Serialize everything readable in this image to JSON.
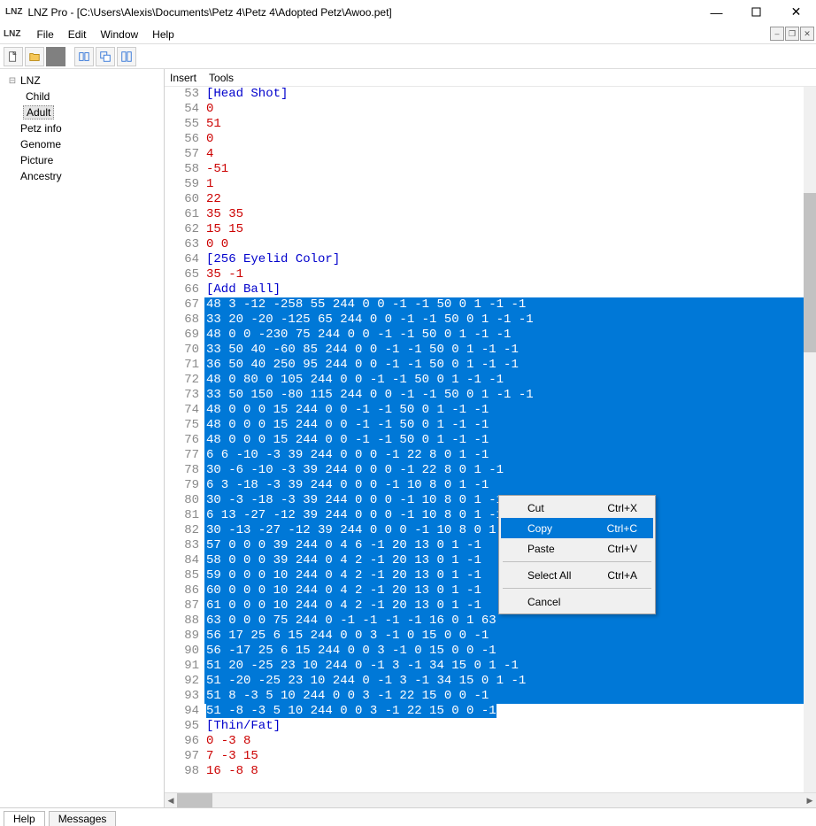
{
  "window": {
    "title": "LNZ Pro - [C:\\Users\\Alexis\\Documents\\Petz 4\\Petz 4\\Adopted Petz\\Awoo.pet]"
  },
  "menubar": [
    "File",
    "Edit",
    "Window",
    "Help"
  ],
  "sidebar": {
    "root": "LNZ",
    "children": [
      "Child",
      "Adult"
    ],
    "selected": "Adult",
    "items": [
      "Petz info",
      "Genome",
      "Picture",
      "Ancestry"
    ]
  },
  "submenu": [
    "Insert",
    "Tools"
  ],
  "context_menu": [
    {
      "label": "Cut",
      "shortcut": "Ctrl+X"
    },
    {
      "label": "Copy",
      "shortcut": "Ctrl+C",
      "hover": true
    },
    {
      "label": "Paste",
      "shortcut": "Ctrl+V"
    },
    "-",
    {
      "label": "Select All",
      "shortcut": "Ctrl+A"
    },
    "-",
    {
      "label": "Cancel",
      "shortcut": ""
    }
  ],
  "status_tabs": [
    "Help",
    "Messages"
  ],
  "editor": {
    "first_line": 53,
    "selection_start": 67,
    "selection_end": 94,
    "lines": [
      {
        "n": 53,
        "t": "section",
        "text": "[Head Shot]"
      },
      {
        "n": 54,
        "t": "num",
        "text": "0"
      },
      {
        "n": 55,
        "t": "num",
        "text": "51"
      },
      {
        "n": 56,
        "t": "num",
        "text": "0"
      },
      {
        "n": 57,
        "t": "num",
        "text": "4"
      },
      {
        "n": 58,
        "t": "num",
        "text": "-51"
      },
      {
        "n": 59,
        "t": "num",
        "text": "1"
      },
      {
        "n": 60,
        "t": "num",
        "text": "22"
      },
      {
        "n": 61,
        "t": "num",
        "text": "35 35"
      },
      {
        "n": 62,
        "t": "num",
        "text": "15 15"
      },
      {
        "n": 63,
        "t": "num",
        "text": "0 0"
      },
      {
        "n": 64,
        "t": "section",
        "text": "[256 Eyelid Color]"
      },
      {
        "n": 65,
        "t": "num",
        "text": "35 -1"
      },
      {
        "n": 66,
        "t": "section",
        "text": "[Add Ball]"
      },
      {
        "n": 67,
        "t": "num",
        "text": "48 3 -12 -258 55 244 0 0 -1 -1 50 0 1 -1 -1"
      },
      {
        "n": 68,
        "t": "num",
        "text": "33 20 -20 -125 65 244 0 0 -1 -1 50 0 1 -1 -1"
      },
      {
        "n": 69,
        "t": "num",
        "text": "48 0 0 -230 75 244 0 0 -1 -1 50 0 1 -1 -1"
      },
      {
        "n": 70,
        "t": "num",
        "text": "33 50 40 -60 85 244 0 0 -1 -1 50 0 1 -1 -1"
      },
      {
        "n": 71,
        "t": "num",
        "text": "36 50 40 250 95 244 0 0 -1 -1 50 0 1 -1 -1"
      },
      {
        "n": 72,
        "t": "num",
        "text": "48 0 80 0 105 244 0 0 -1 -1 50 0 1 -1 -1"
      },
      {
        "n": 73,
        "t": "num",
        "text": "33 50 150 -80 115 244 0 0 -1 -1 50 0 1 -1 -1"
      },
      {
        "n": 74,
        "t": "num",
        "text": "48 0 0 0 15 244 0 0 -1 -1 50 0 1 -1 -1"
      },
      {
        "n": 75,
        "t": "num",
        "text": "48 0 0 0 15 244 0 0 -1 -1 50 0 1 -1 -1"
      },
      {
        "n": 76,
        "t": "num",
        "text": "48 0 0 0 15 244 0 0 -1 -1 50 0 1 -1 -1"
      },
      {
        "n": 77,
        "t": "num",
        "text": "6 6 -10 -3 39 244 0 0 0 -1 22 8 0 1 -1"
      },
      {
        "n": 78,
        "t": "num",
        "text": "30 -6 -10 -3 39 244 0 0 0 -1 22 8 0 1 -1"
      },
      {
        "n": 79,
        "t": "num",
        "text": "6 3 -18 -3 39 244 0 0 0 -1 10 8 0 1 -1"
      },
      {
        "n": 80,
        "t": "num",
        "text": "30 -3 -18 -3 39 244 0 0 0 -1 10 8 0 1 -1"
      },
      {
        "n": 81,
        "t": "num",
        "text": "6 13 -27 -12 39 244 0 0 0 -1 10 8 0 1 -1"
      },
      {
        "n": 82,
        "t": "num",
        "text": "30 -13 -27 -12 39 244 0 0 0 -1 10 8 0 1 -1"
      },
      {
        "n": 83,
        "t": "num",
        "text": "57 0 0 0 39 244 0 4 6 -1 20 13 0 1 -1"
      },
      {
        "n": 84,
        "t": "num",
        "text": "58 0 0 0 39 244 0 4 2 -1 20 13 0 1 -1"
      },
      {
        "n": 85,
        "t": "num",
        "text": "59 0 0 0 10 244 0 4 2 -1 20 13 0 1 -1"
      },
      {
        "n": 86,
        "t": "num",
        "text": "60 0 0 0 10 244 0 4 2 -1 20 13 0 1 -1"
      },
      {
        "n": 87,
        "t": "num",
        "text": "61 0 0 0 10 244 0 4 2 -1 20 13 0 1 -1"
      },
      {
        "n": 88,
        "t": "num",
        "text": "63 0 0 0 75 244 0 -1 -1 -1 -1 16 0 1 63"
      },
      {
        "n": 89,
        "t": "num",
        "text": "56 17 25 6 15 244 0 0 3 -1 0 15 0 0 -1"
      },
      {
        "n": 90,
        "t": "num",
        "text": "56 -17 25 6 15 244 0 0 3 -1 0 15 0 0 -1"
      },
      {
        "n": 91,
        "t": "num",
        "text": "51 20 -25 23 10 244 0 -1 3 -1 34 15 0 1 -1"
      },
      {
        "n": 92,
        "t": "num",
        "text": "51 -20 -25 23 10 244 0 -1 3 -1 34 15 0 1 -1"
      },
      {
        "n": 93,
        "t": "num",
        "text": "51 8 -3 5 10 244 0 0 3 -1 22 15 0 0 -1"
      },
      {
        "n": 94,
        "t": "num",
        "text": "51 -8 -3 5 10 244 0 0 3 -1 22 15 0 0 -1"
      },
      {
        "n": 95,
        "t": "section",
        "text": "[Thin/Fat]"
      },
      {
        "n": 96,
        "t": "num",
        "text": "0 -3 8"
      },
      {
        "n": 97,
        "t": "num",
        "text": "7 -3 15"
      },
      {
        "n": 98,
        "t": "num",
        "text": "16 -8 8"
      }
    ]
  }
}
